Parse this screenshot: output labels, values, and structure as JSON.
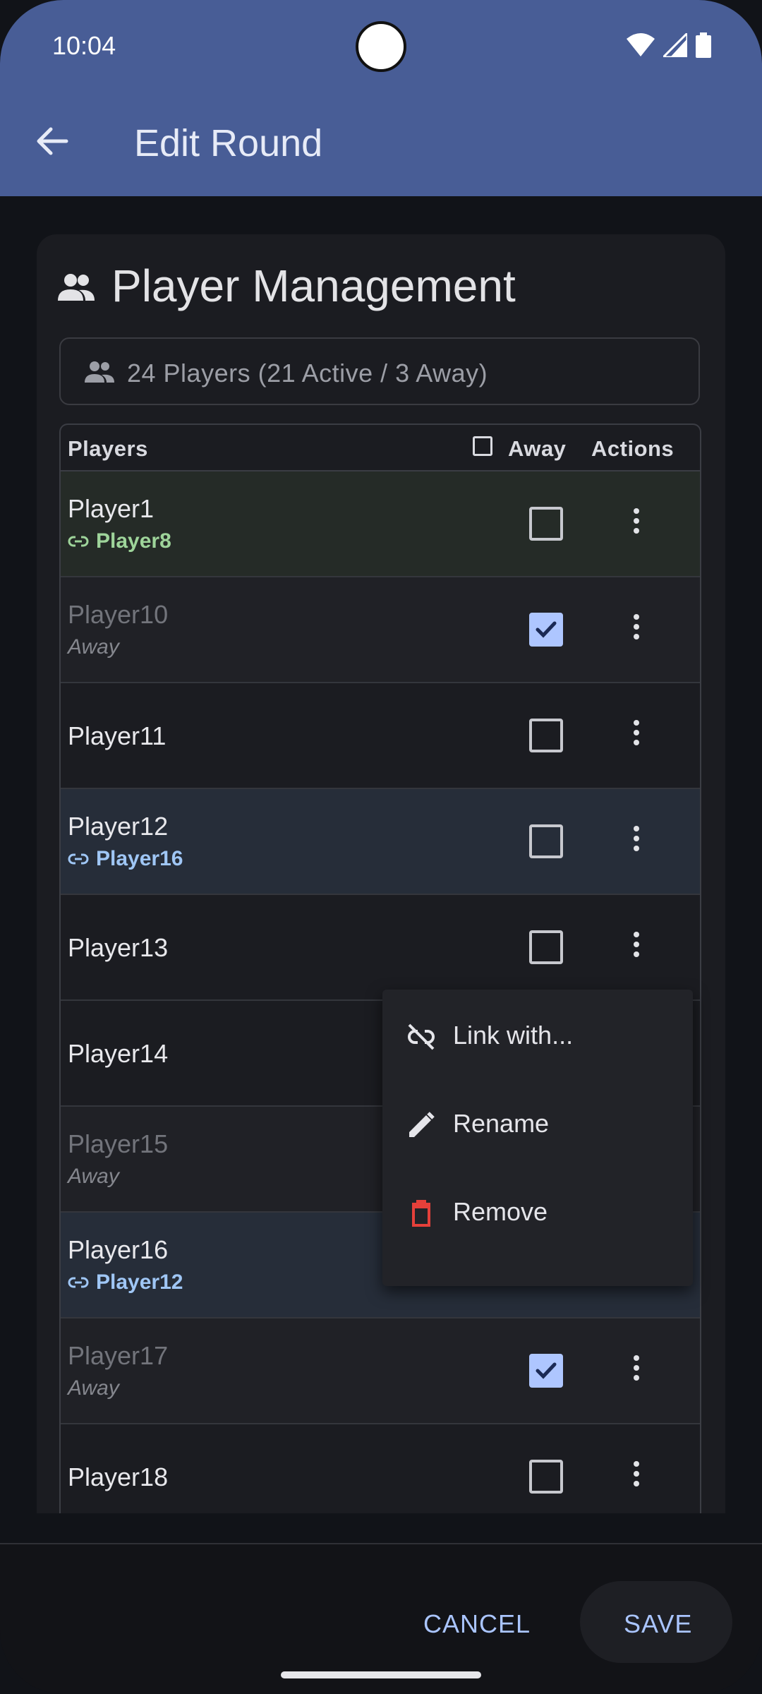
{
  "status": {
    "time": "10:04"
  },
  "appbar": {
    "title": "Edit Round",
    "back_icon": "arrow-left-icon"
  },
  "card": {
    "title": "Player Management",
    "count_text": "24 Players (21 Active / 3 Away)"
  },
  "table": {
    "headers": {
      "players": "Players",
      "away": "Away",
      "actions": "Actions"
    },
    "rows": [
      {
        "name": "Player1",
        "sub": "Player8",
        "sub_type": "link-green",
        "away": false
      },
      {
        "name": "Player10",
        "sub": "Away",
        "sub_type": "away",
        "away": true
      },
      {
        "name": "Player11",
        "sub": "",
        "sub_type": "none",
        "away": false
      },
      {
        "name": "Player12",
        "sub": "Player16",
        "sub_type": "link-blue",
        "away": false
      },
      {
        "name": "Player13",
        "sub": "",
        "sub_type": "none",
        "away": false
      },
      {
        "name": "Player14",
        "sub": "",
        "sub_type": "none",
        "away": false
      },
      {
        "name": "Player15",
        "sub": "Away",
        "sub_type": "away",
        "away": true
      },
      {
        "name": "Player16",
        "sub": "Player12",
        "sub_type": "link-blue",
        "away": false
      },
      {
        "name": "Player17",
        "sub": "Away",
        "sub_type": "away",
        "away": true
      },
      {
        "name": "Player18",
        "sub": "",
        "sub_type": "none",
        "away": false
      }
    ]
  },
  "menu": {
    "items": [
      {
        "label": "Link with...",
        "icon": "link-off-icon"
      },
      {
        "label": "Rename",
        "icon": "pencil-icon"
      },
      {
        "label": "Remove",
        "icon": "trash-icon"
      }
    ]
  },
  "footer": {
    "cancel": "CANCEL",
    "save": "SAVE"
  },
  "colors": {
    "appbar": "#485d96",
    "accent": "#aac5ff",
    "link_green": "#9ed49a",
    "link_blue": "#9fc6f5",
    "danger": "#e5403a"
  }
}
